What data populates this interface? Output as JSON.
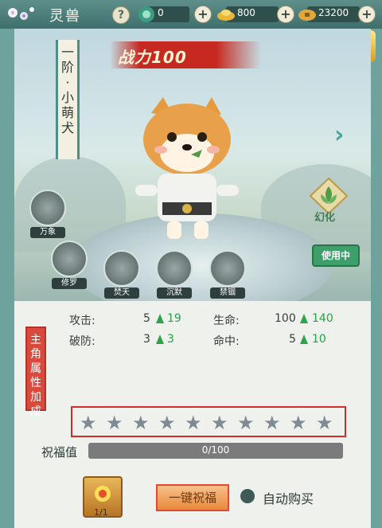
{
  "header": {
    "title": "灵兽",
    "help_icon": "question-icon",
    "resources": [
      {
        "name": "jade",
        "icon": "jade-orb-icon",
        "value": "0"
      },
      {
        "name": "gold",
        "icon": "gold-ingot-icon",
        "value": "800"
      },
      {
        "name": "copper",
        "icon": "coin-icon",
        "value": "23200"
      }
    ]
  },
  "pet": {
    "name_scroll": "一阶·小萌犬",
    "power_label": "战力100",
    "morph_label": "幻化",
    "in_use_label": "使用中"
  },
  "skills": [
    {
      "label": "万象"
    },
    {
      "label": "修罗"
    },
    {
      "label": "焚天"
    },
    {
      "label": "沉默"
    },
    {
      "label": "禁锢"
    }
  ],
  "attributes": {
    "section_title": "主角属性加成",
    "stats": [
      {
        "label": "攻击:",
        "value": "5",
        "next": "19"
      },
      {
        "label": "生命:",
        "value": "100",
        "next": "140"
      },
      {
        "label": "破防:",
        "value": "3",
        "next": "3"
      },
      {
        "label": "命中:",
        "value": "5",
        "next": "10"
      }
    ]
  },
  "stars": {
    "filled": 0,
    "total": 10
  },
  "blessing": {
    "label": "祝福值",
    "progress_text": "0/100",
    "current": 0,
    "max": 100
  },
  "footer": {
    "item_count": "1/1",
    "bless_button": "一键祝福",
    "auto_buy_label": "自动购买"
  },
  "colors": {
    "accent_green": "#28a14a",
    "highlight_red": "#d12c2c",
    "frame_teal": "#6da39c"
  }
}
